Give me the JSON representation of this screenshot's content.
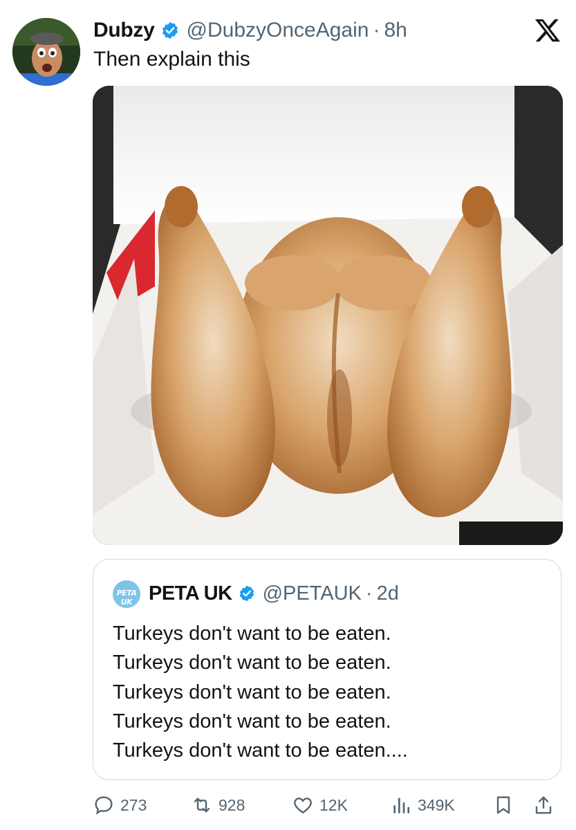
{
  "post": {
    "author_name": "Dubzy",
    "author_handle": "@DubzyOnceAgain",
    "separator": "·",
    "time": "8h",
    "text": "Then explain this",
    "icons": {
      "verified": "verified-badge-icon",
      "platform": "x-logo-icon"
    }
  },
  "quote": {
    "author_name": "PETA UK",
    "author_handle": "@PETAUK",
    "separator": "·",
    "time": "2d",
    "avatar_text": "PETA UK",
    "lines": [
      "Turkeys don't want to be eaten.",
      "Turkeys don't want to be eaten.",
      "Turkeys don't want to be eaten.",
      "Turkeys don't want to be eaten.",
      "Turkeys don't want to be eaten...."
    ]
  },
  "actions": {
    "replies": "273",
    "reposts": "928",
    "likes": "12K",
    "views": "349K",
    "icons": [
      "reply-icon",
      "repost-icon",
      "like-icon",
      "views-icon",
      "bookmark-icon",
      "share-icon"
    ]
  },
  "colors": {
    "text": "#0f1419",
    "secondary": "#536471",
    "verified_blue": "#1d9bf0",
    "border": "#cfd9de"
  }
}
